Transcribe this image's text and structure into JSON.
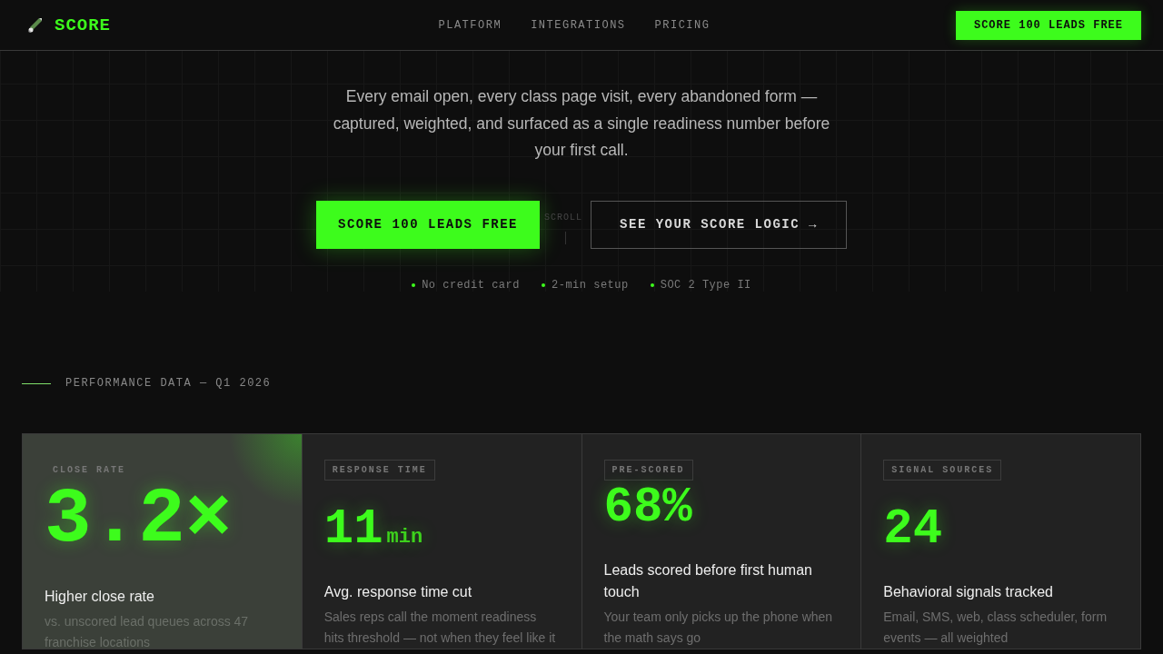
{
  "nav": {
    "brand": "SCORE",
    "links": [
      "PLATFORM",
      "INTEGRATIONS",
      "PRICING"
    ],
    "cta": "SCORE 100 LEADS FREE"
  },
  "hero": {
    "subtitle": "Every email open, every class page visit, every abandoned form — captured, weighted, and surfaced as a single readiness number before your first call.",
    "primary_button": "SCORE 100 LEADS FREE",
    "scroll_hint": "SCROLL",
    "secondary_button": "SEE YOUR SCORE LOGIC →",
    "checks": [
      "No credit card",
      "2-min setup",
      "SOC 2 Type II"
    ]
  },
  "section_label": "PERFORMANCE DATA — Q1 2026",
  "cards": [
    {
      "label": "CLOSE RATE",
      "value": "3.2×",
      "title": "Higher close rate",
      "description": "vs. unscored lead queues across 47 franchise locations",
      "highlighted": true
    },
    {
      "label": "RESPONSE TIME",
      "value": "11",
      "unit": "min",
      "title": "Avg. response time cut",
      "description": "Sales reps call the moment readiness hits threshold — not when they feel like it",
      "highlighted": false
    },
    {
      "label": "PRE-SCORED",
      "value": "68%",
      "title": "Leads scored before first human touch",
      "description": "Your team only picks up the phone when the math says go",
      "highlighted": false
    },
    {
      "label": "SIGNAL SOURCES",
      "value": "24",
      "title": "Behavioral signals tracked",
      "description": "Email, SMS, web, class scheduler, form events — all weighted",
      "highlighted": false
    }
  ]
}
